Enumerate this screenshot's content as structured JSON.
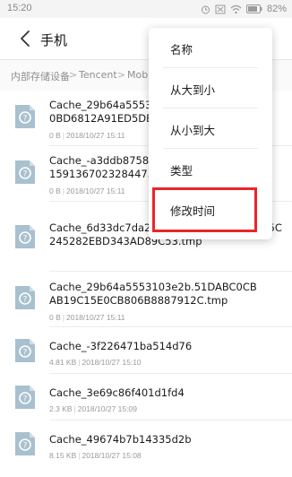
{
  "status_bar": {
    "time": "15:20",
    "battery_percent": "82%"
  },
  "app_bar": {
    "title": "手机"
  },
  "breadcrumb": {
    "items": [
      "内部存储设备",
      "Tencent",
      "Mobil"
    ]
  },
  "files": [
    {
      "name": "Cache_29b64a5553\n0BD6812A91ED5DE",
      "size": "0 B",
      "date": "2018/10/27 15:11"
    },
    {
      "name": "Cache_-a3ddb8758\n15913670232844751",
      "size": "0 B",
      "date": "2018/10/27 15:11"
    },
    {
      "name": "Cache_6d33dc7da294ea44.8268C6F601\n15C245282EBD343AD89C53.tmp",
      "size": "0 B",
      "date": "2018/10/27 15:11"
    },
    {
      "name": "Cache_29b64a5553103e2b.51DABC0CB\nAB19C15E0CB806B8887912C.tmp",
      "size": "0 B",
      "date": "2018/10/27 15:11"
    },
    {
      "name": "Cache_-3f226471ba514d76",
      "size": "4.81 KB",
      "date": "2018/10/27 15:10"
    },
    {
      "name": "Cache_3e69c86f401d1fd4",
      "size": "2.3 KB",
      "date": "2018/10/27 15:09"
    },
    {
      "name": "Cache_49674b7b14335d2b",
      "size": "8.15 KB",
      "date": "2018/10/27 15:08"
    }
  ],
  "sort_menu": {
    "items": [
      "名称",
      "从大到小",
      "从小到大",
      "类型",
      "修改时间"
    ],
    "highlighted": "修改时间",
    "highlight_color": "#e8262a"
  },
  "icons": {
    "file": "unknown-file-icon",
    "back": "back-arrow-icon"
  }
}
